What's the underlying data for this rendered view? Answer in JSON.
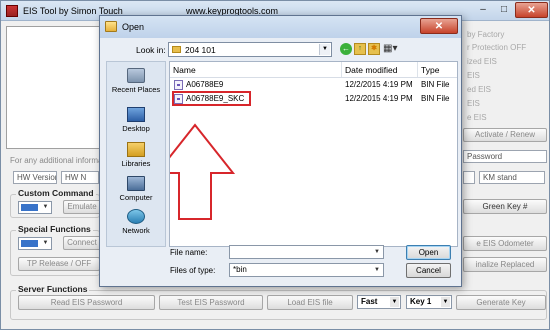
{
  "app": {
    "title": "EIS Tool by Simon Touch",
    "url": "www.keyprogtools.com",
    "window_controls": {
      "minimize": "–",
      "maximize": "□",
      "close": "✕"
    },
    "right_panel_labels": [
      "by Factory",
      "r Protection OFF",
      "ized EIS",
      "EIS",
      "ed EIS",
      "EIS",
      "e EIS"
    ],
    "note": "For any additional informa",
    "hw_version": "HW Version",
    "hw_n": "HW N",
    "activate_renew": "Activate / Renew",
    "password_field": "Password",
    "km_stand": "KM stand",
    "green_key": "Green Key #",
    "erase_odometer": "e EIS Odometer",
    "finalize_replaced": "inalize Replaced",
    "custom_command": {
      "title": "Custom Command",
      "emulate": "Emulate"
    },
    "special_functions": {
      "title": "Special Functions",
      "connect": "Connect",
      "tp_release_off": "TP Release / OFF"
    },
    "server_functions": {
      "title": "Server Functions",
      "read_eis_password": "Read EIS Password",
      "test_eis_password": "Test EIS Password",
      "load_eis_file": "Load EIS file",
      "speed": "Fast",
      "key": "Key 1",
      "generate_key": "Generate Key"
    }
  },
  "dialog": {
    "title": "Open",
    "close": "✕",
    "look_in_label": "Look in:",
    "look_in_value": "204 101",
    "places": [
      {
        "label": "Recent Places",
        "icon": "recent-places-icon"
      },
      {
        "label": "Desktop",
        "icon": "desktop-icon"
      },
      {
        "label": "Libraries",
        "icon": "libraries-icon"
      },
      {
        "label": "Computer",
        "icon": "computer-icon"
      },
      {
        "label": "Network",
        "icon": "network-icon"
      }
    ],
    "columns": {
      "name": "Name",
      "date": "Date modified",
      "type": "Type"
    },
    "files": [
      {
        "name": "A06788E9",
        "date": "12/2/2015 4:19 PM",
        "type": "BIN File"
      },
      {
        "name": "A06788E9_SKC",
        "date": "12/2/2015 4:19 PM",
        "type": "BIN File"
      }
    ],
    "file_name_label": "File name:",
    "file_name_value": "",
    "files_of_type_label": "Files of type:",
    "files_of_type_value": "*bin",
    "open_button": "Open",
    "cancel_button": "Cancel"
  },
  "colors": {
    "highlight": "#d7262b",
    "dialog_bg": "#e9eef5",
    "window_bg": "#f0f0f0"
  }
}
